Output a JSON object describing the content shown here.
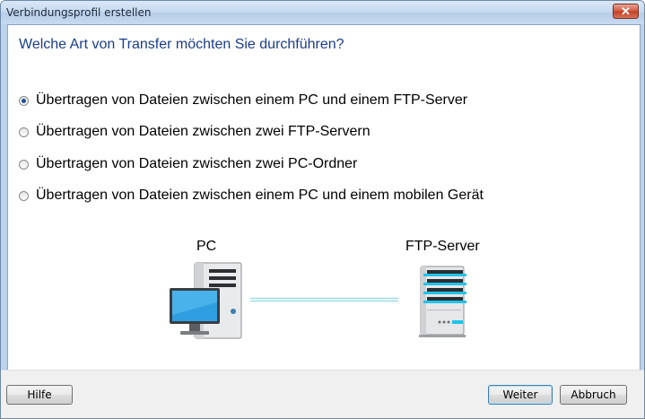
{
  "window": {
    "title": "Verbindungsprofil erstellen",
    "close_symbol": "✕"
  },
  "main": {
    "heading": "Welche Art von Transfer möchten Sie durchführen?",
    "options": [
      {
        "label": "Übertragen von Dateien zwischen einem PC und einem FTP-Server",
        "checked": true
      },
      {
        "label": "Übertragen von Dateien zwischen zwei FTP-Servern",
        "checked": false
      },
      {
        "label": "Übertragen von Dateien zwischen zwei PC-Ordner",
        "checked": false
      },
      {
        "label": "Übertragen von Dateien zwischen einem PC und einem mobilen Gerät",
        "checked": false
      }
    ],
    "diagram": {
      "left_label": "PC",
      "right_label": "FTP-Server",
      "left_icon": "computer-icon",
      "right_icon": "server-icon",
      "accent_color": "#21c3e8"
    }
  },
  "footer": {
    "help_label": "Hilfe",
    "next_label": "Weiter",
    "cancel_label": "Abbruch"
  }
}
